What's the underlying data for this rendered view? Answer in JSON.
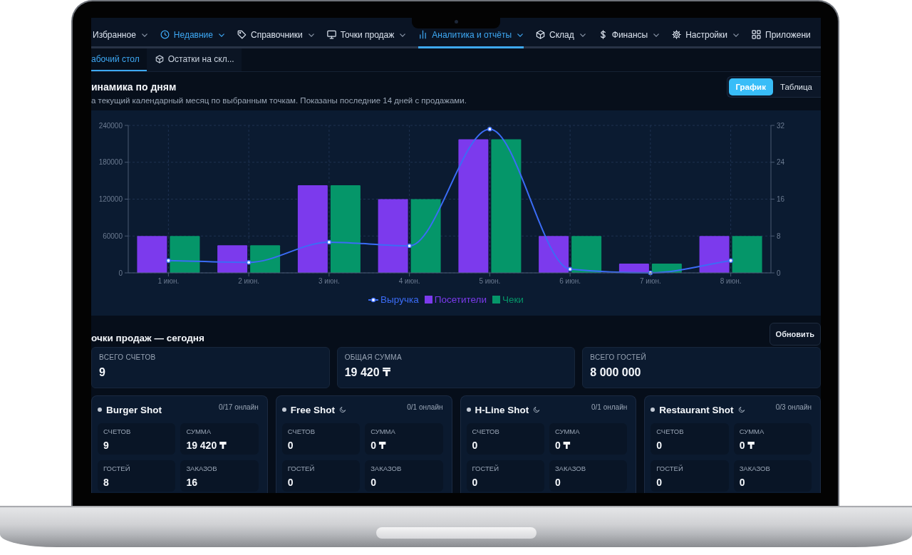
{
  "nav": {
    "items": [
      {
        "label": "Избранное",
        "dropdown": true,
        "selected": false,
        "highlighted": false
      },
      {
        "label": "Недавние",
        "dropdown": true,
        "selected": false,
        "highlighted": true
      },
      {
        "label": "Справочники",
        "dropdown": true,
        "selected": false,
        "highlighted": false
      },
      {
        "label": "Точки продаж",
        "dropdown": true,
        "selected": false,
        "highlighted": false
      },
      {
        "label": "Аналитика и отчёты",
        "dropdown": true,
        "selected": true,
        "highlighted": false
      },
      {
        "label": "Склад",
        "dropdown": true,
        "selected": false,
        "highlighted": false
      },
      {
        "label": "Финансы",
        "dropdown": true,
        "selected": false,
        "highlighted": false
      },
      {
        "label": "Настройки",
        "dropdown": true,
        "selected": false,
        "highlighted": false
      },
      {
        "label": "Приложени",
        "dropdown": false,
        "selected": false,
        "highlighted": false
      }
    ]
  },
  "subtabs": [
    {
      "label": "абочий стол",
      "selected": true
    },
    {
      "label": "Остатки на скл...",
      "selected": false
    }
  ],
  "sales_chart": {
    "title": "инамика по дням",
    "subtitle": "а текущий календарный месяц по выбранным точкам. Показаны последние 14 дней с продажами.",
    "views": [
      {
        "label": "График",
        "selected": true
      },
      {
        "label": "Таблица",
        "selected": false
      }
    ],
    "chart_data": {
      "type": "bar",
      "categories": [
        "1 июн.",
        "2 июн.",
        "3 июн.",
        "4 июн.",
        "5 июн.",
        "6 июн.",
        "7 июн.",
        "8 июн."
      ],
      "series": [
        {
          "name": "Выручка",
          "type": "line",
          "marker": "circle",
          "color": "#3b6cf6",
          "values": [
            20000,
            17000,
            50000,
            44000,
            234000,
            6000,
            0,
            20000
          ]
        },
        {
          "name": "Посетители",
          "type": "bar",
          "axis": "y2",
          "color": "#7c3aed",
          "values": [
            8,
            6,
            19,
            16,
            29,
            8,
            2,
            8
          ]
        },
        {
          "name": "Чеки",
          "type": "bar",
          "axis": "y2",
          "color": "#059669",
          "values": [
            8,
            6,
            19,
            16,
            29,
            8,
            2,
            8
          ]
        }
      ],
      "stacked": false,
      "grid": true,
      "legend": "bottom",
      "ylim": [
        0,
        240000
      ],
      "yticks": [
        0,
        60000,
        120000,
        180000,
        240000
      ],
      "y2lim": [
        0,
        32
      ],
      "y2ticks": [
        0,
        8,
        16,
        24,
        32
      ]
    }
  },
  "points_today": {
    "title": "очки продаж — сегодня",
    "refresh_button": "Обновить",
    "totals": [
      {
        "label": "ВСЕГО СЧЕТОВ",
        "value": "9"
      },
      {
        "label": "ОБЩАЯ СУММА",
        "value": "19 420 ₸"
      },
      {
        "label": "ВСЕГО ГОСТЕЙ",
        "value": "8 000 000"
      }
    ],
    "points": [
      {
        "name": "Burger Shot",
        "sleeping": false,
        "online": "0/17 онлайн",
        "metrics": [
          {
            "label": "СЧЕТОВ",
            "value": "9"
          },
          {
            "label": "СУММА",
            "value": "19 420 ₸"
          },
          {
            "label": "ГОСТЕЙ",
            "value": "8"
          },
          {
            "label": "ЗАКАЗОВ",
            "value": "16"
          }
        ]
      },
      {
        "name": "Free Shot",
        "sleeping": true,
        "online": "0/1 онлайн",
        "metrics": [
          {
            "label": "СЧЕТОВ",
            "value": "0"
          },
          {
            "label": "СУММА",
            "value": "0 ₸"
          },
          {
            "label": "ГОСТЕЙ",
            "value": "0"
          },
          {
            "label": "ЗАКАЗОВ",
            "value": "0"
          }
        ]
      },
      {
        "name": "H-Line Shot",
        "sleeping": true,
        "online": "0/1 онлайн",
        "metrics": [
          {
            "label": "СЧЕТОВ",
            "value": "0"
          },
          {
            "label": "СУММА",
            "value": "0 ₸"
          },
          {
            "label": "ГОСТЕЙ",
            "value": "0"
          },
          {
            "label": "ЗАКАЗОВ",
            "value": "0"
          }
        ]
      },
      {
        "name": "Restaurant Shot",
        "sleeping": true,
        "online": "0/3 онлайн",
        "metrics": [
          {
            "label": "СЧЕТОВ",
            "value": "0"
          },
          {
            "label": "СУММА",
            "value": "0 ₸"
          },
          {
            "label": "ГОСТЕЙ",
            "value": "0"
          },
          {
            "label": "ЗАКАЗОВ",
            "value": "0"
          }
        ]
      }
    ]
  }
}
